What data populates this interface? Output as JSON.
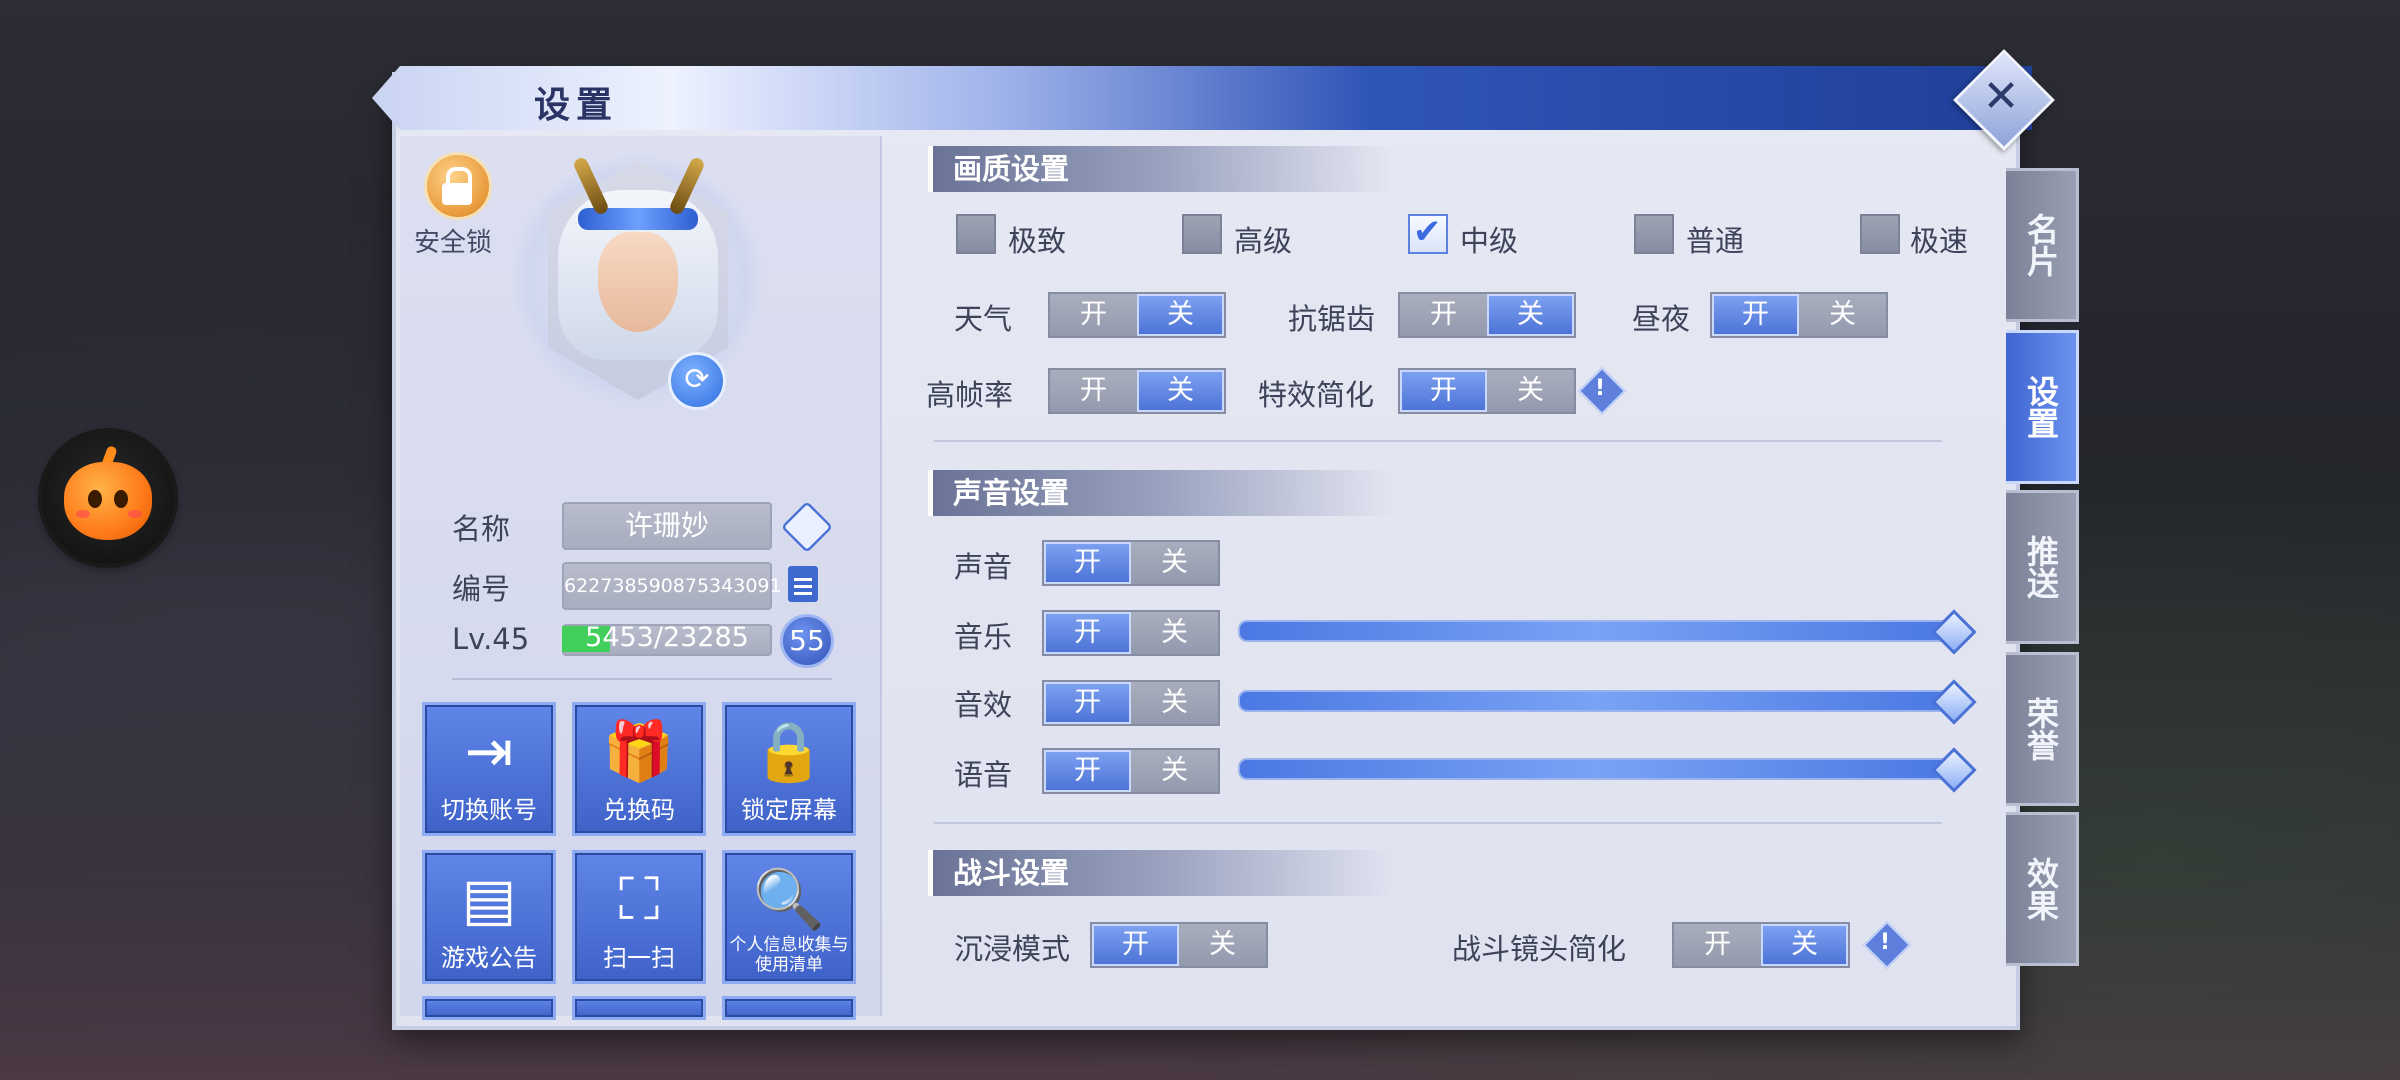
{
  "window": {
    "title": "设置",
    "close": "✕"
  },
  "profile": {
    "lock_label": "安全锁",
    "name_label": "名称",
    "name_value": "许珊妙",
    "id_label": "编号",
    "id_value": "622738590875343091",
    "level_label": "Lv.45",
    "exp_text": "5453/23285",
    "exp_progress": 0.234,
    "level_badge": "55",
    "refresh_icon": "⟳"
  },
  "actions": [
    {
      "label": "切换账号",
      "icon": "⇥"
    },
    {
      "label": "兑换码",
      "icon": "🎁"
    },
    {
      "label": "锁定屏幕",
      "icon": "🔒"
    },
    {
      "label": "游戏公告",
      "icon": "▤"
    },
    {
      "label": "扫一扫",
      "icon": "⛶"
    },
    {
      "label": "个人信息收集与使用清单",
      "icon": "🔍"
    }
  ],
  "graphics": {
    "title": "画质设置",
    "quality_options": [
      "极致",
      "高级",
      "中级",
      "普通",
      "极速"
    ],
    "selected_quality": "中级",
    "rows": [
      {
        "label": "天气",
        "on": "开",
        "off": "关",
        "state": "off"
      },
      {
        "label": "抗锯齿",
        "on": "开",
        "off": "关",
        "state": "off"
      },
      {
        "label": "昼夜",
        "on": "开",
        "off": "关",
        "state": "on"
      },
      {
        "label": "高帧率",
        "on": "开",
        "off": "关",
        "state": "off"
      },
      {
        "label": "特效简化",
        "on": "开",
        "off": "关",
        "state": "on"
      }
    ]
  },
  "sound": {
    "title": "声音设置",
    "rows": [
      {
        "label": "声音",
        "on": "开",
        "off": "关",
        "state": "on"
      },
      {
        "label": "音乐",
        "on": "开",
        "off": "关",
        "state": "on",
        "volume": 1.0
      },
      {
        "label": "音效",
        "on": "开",
        "off": "关",
        "state": "on",
        "volume": 1.0
      },
      {
        "label": "语音",
        "on": "开",
        "off": "关",
        "state": "on",
        "volume": 1.0
      }
    ]
  },
  "battle": {
    "title": "战斗设置",
    "rows": [
      {
        "label": "沉浸模式",
        "on": "开",
        "off": "关",
        "state": "on"
      },
      {
        "label": "战斗镜头简化",
        "on": "开",
        "off": "关",
        "state": "off"
      }
    ]
  },
  "side_tabs": [
    {
      "label": "名片",
      "active": false
    },
    {
      "label": "设置",
      "active": true
    },
    {
      "label": "推送",
      "active": false
    },
    {
      "label": "荣誉",
      "active": false
    },
    {
      "label": "效果",
      "active": false
    }
  ],
  "icons": {
    "edit": "pencil-icon",
    "copy": "copy-icon",
    "warn": "!",
    "assistant": "pumpkin-icon"
  }
}
